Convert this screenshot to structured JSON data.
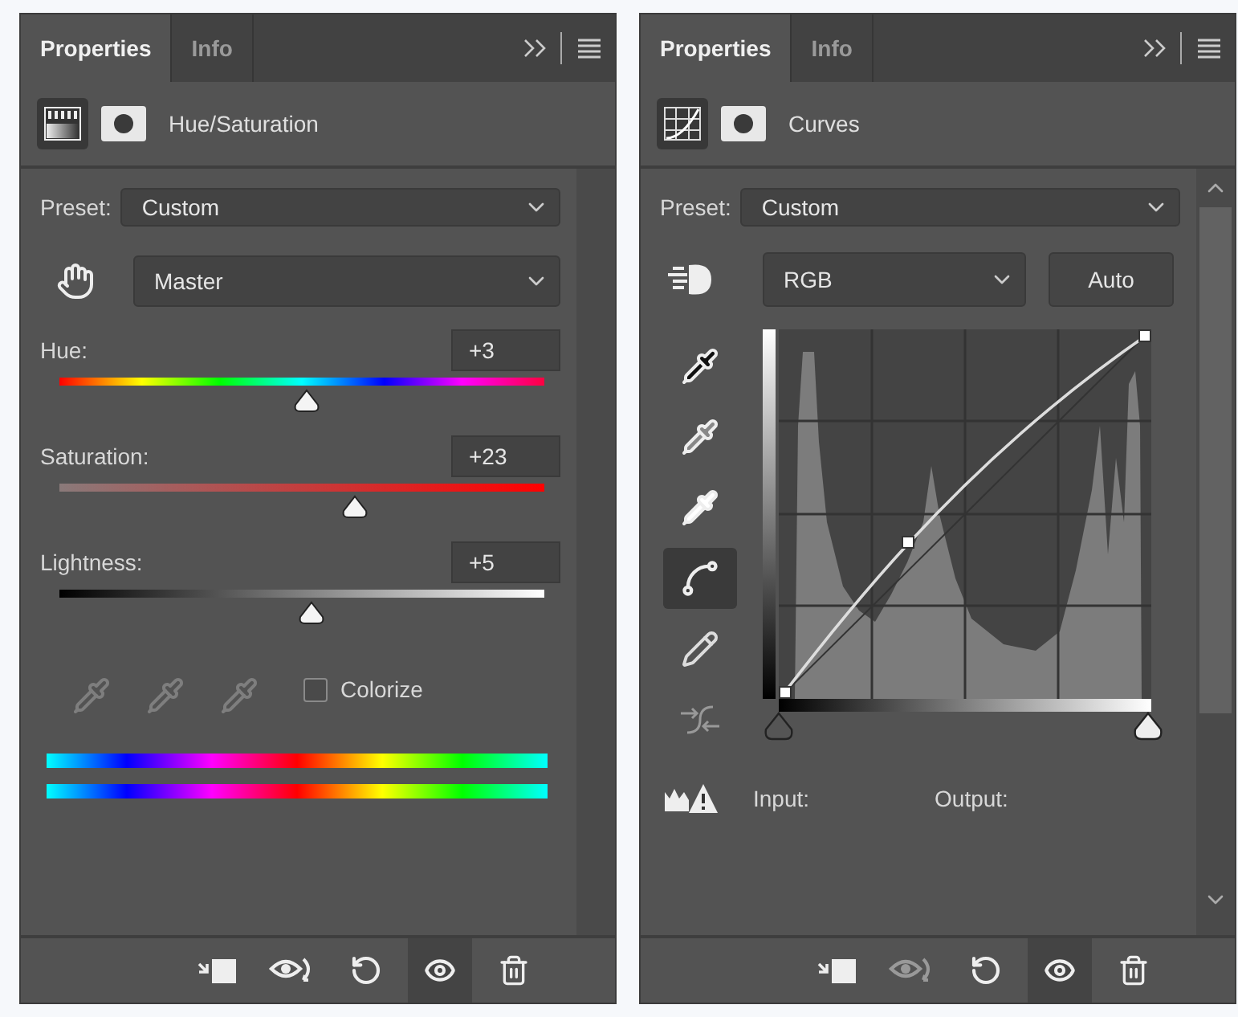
{
  "panels": [
    {
      "kind": "hue_saturation",
      "tabs": [
        {
          "label": "Properties",
          "selected": true
        },
        {
          "label": "Info",
          "selected": false
        }
      ],
      "title": "Hue/Saturation",
      "preset_label": "Preset:",
      "preset": "Custom",
      "channel": "Master",
      "sliders": [
        {
          "kind": "hue",
          "label": "Hue:",
          "value": "+3",
          "level": 0.51
        },
        {
          "kind": "saturation",
          "label": "Saturation:",
          "value": "+23",
          "level": 0.61
        },
        {
          "kind": "lightness",
          "label": "Lightness:",
          "value": "+5",
          "level": 0.52
        }
      ],
      "eyedroppers_disabled": true,
      "colorize": {
        "label": "Colorize",
        "checked": false
      },
      "view_previous_disabled": false
    },
    {
      "kind": "curves",
      "tabs": [
        {
          "label": "Properties",
          "selected": true
        },
        {
          "label": "Info",
          "selected": false
        }
      ],
      "title": "Curves",
      "preset_label": "Preset:",
      "preset": "Custom",
      "channel": "RGB",
      "auto": "Auto",
      "tools": [
        {
          "kind": "shadow",
          "selected": false
        },
        {
          "kind": "midtone",
          "selected": false
        },
        {
          "kind": "highlight",
          "selected": false
        },
        {
          "kind": "curve",
          "selected": true
        },
        {
          "kind": "pencil",
          "selected": false
        },
        {
          "kind": "smooth",
          "selected": false
        }
      ],
      "input_label": "Input:",
      "output_label": "Output:",
      "view_previous_disabled": true
    }
  ]
}
